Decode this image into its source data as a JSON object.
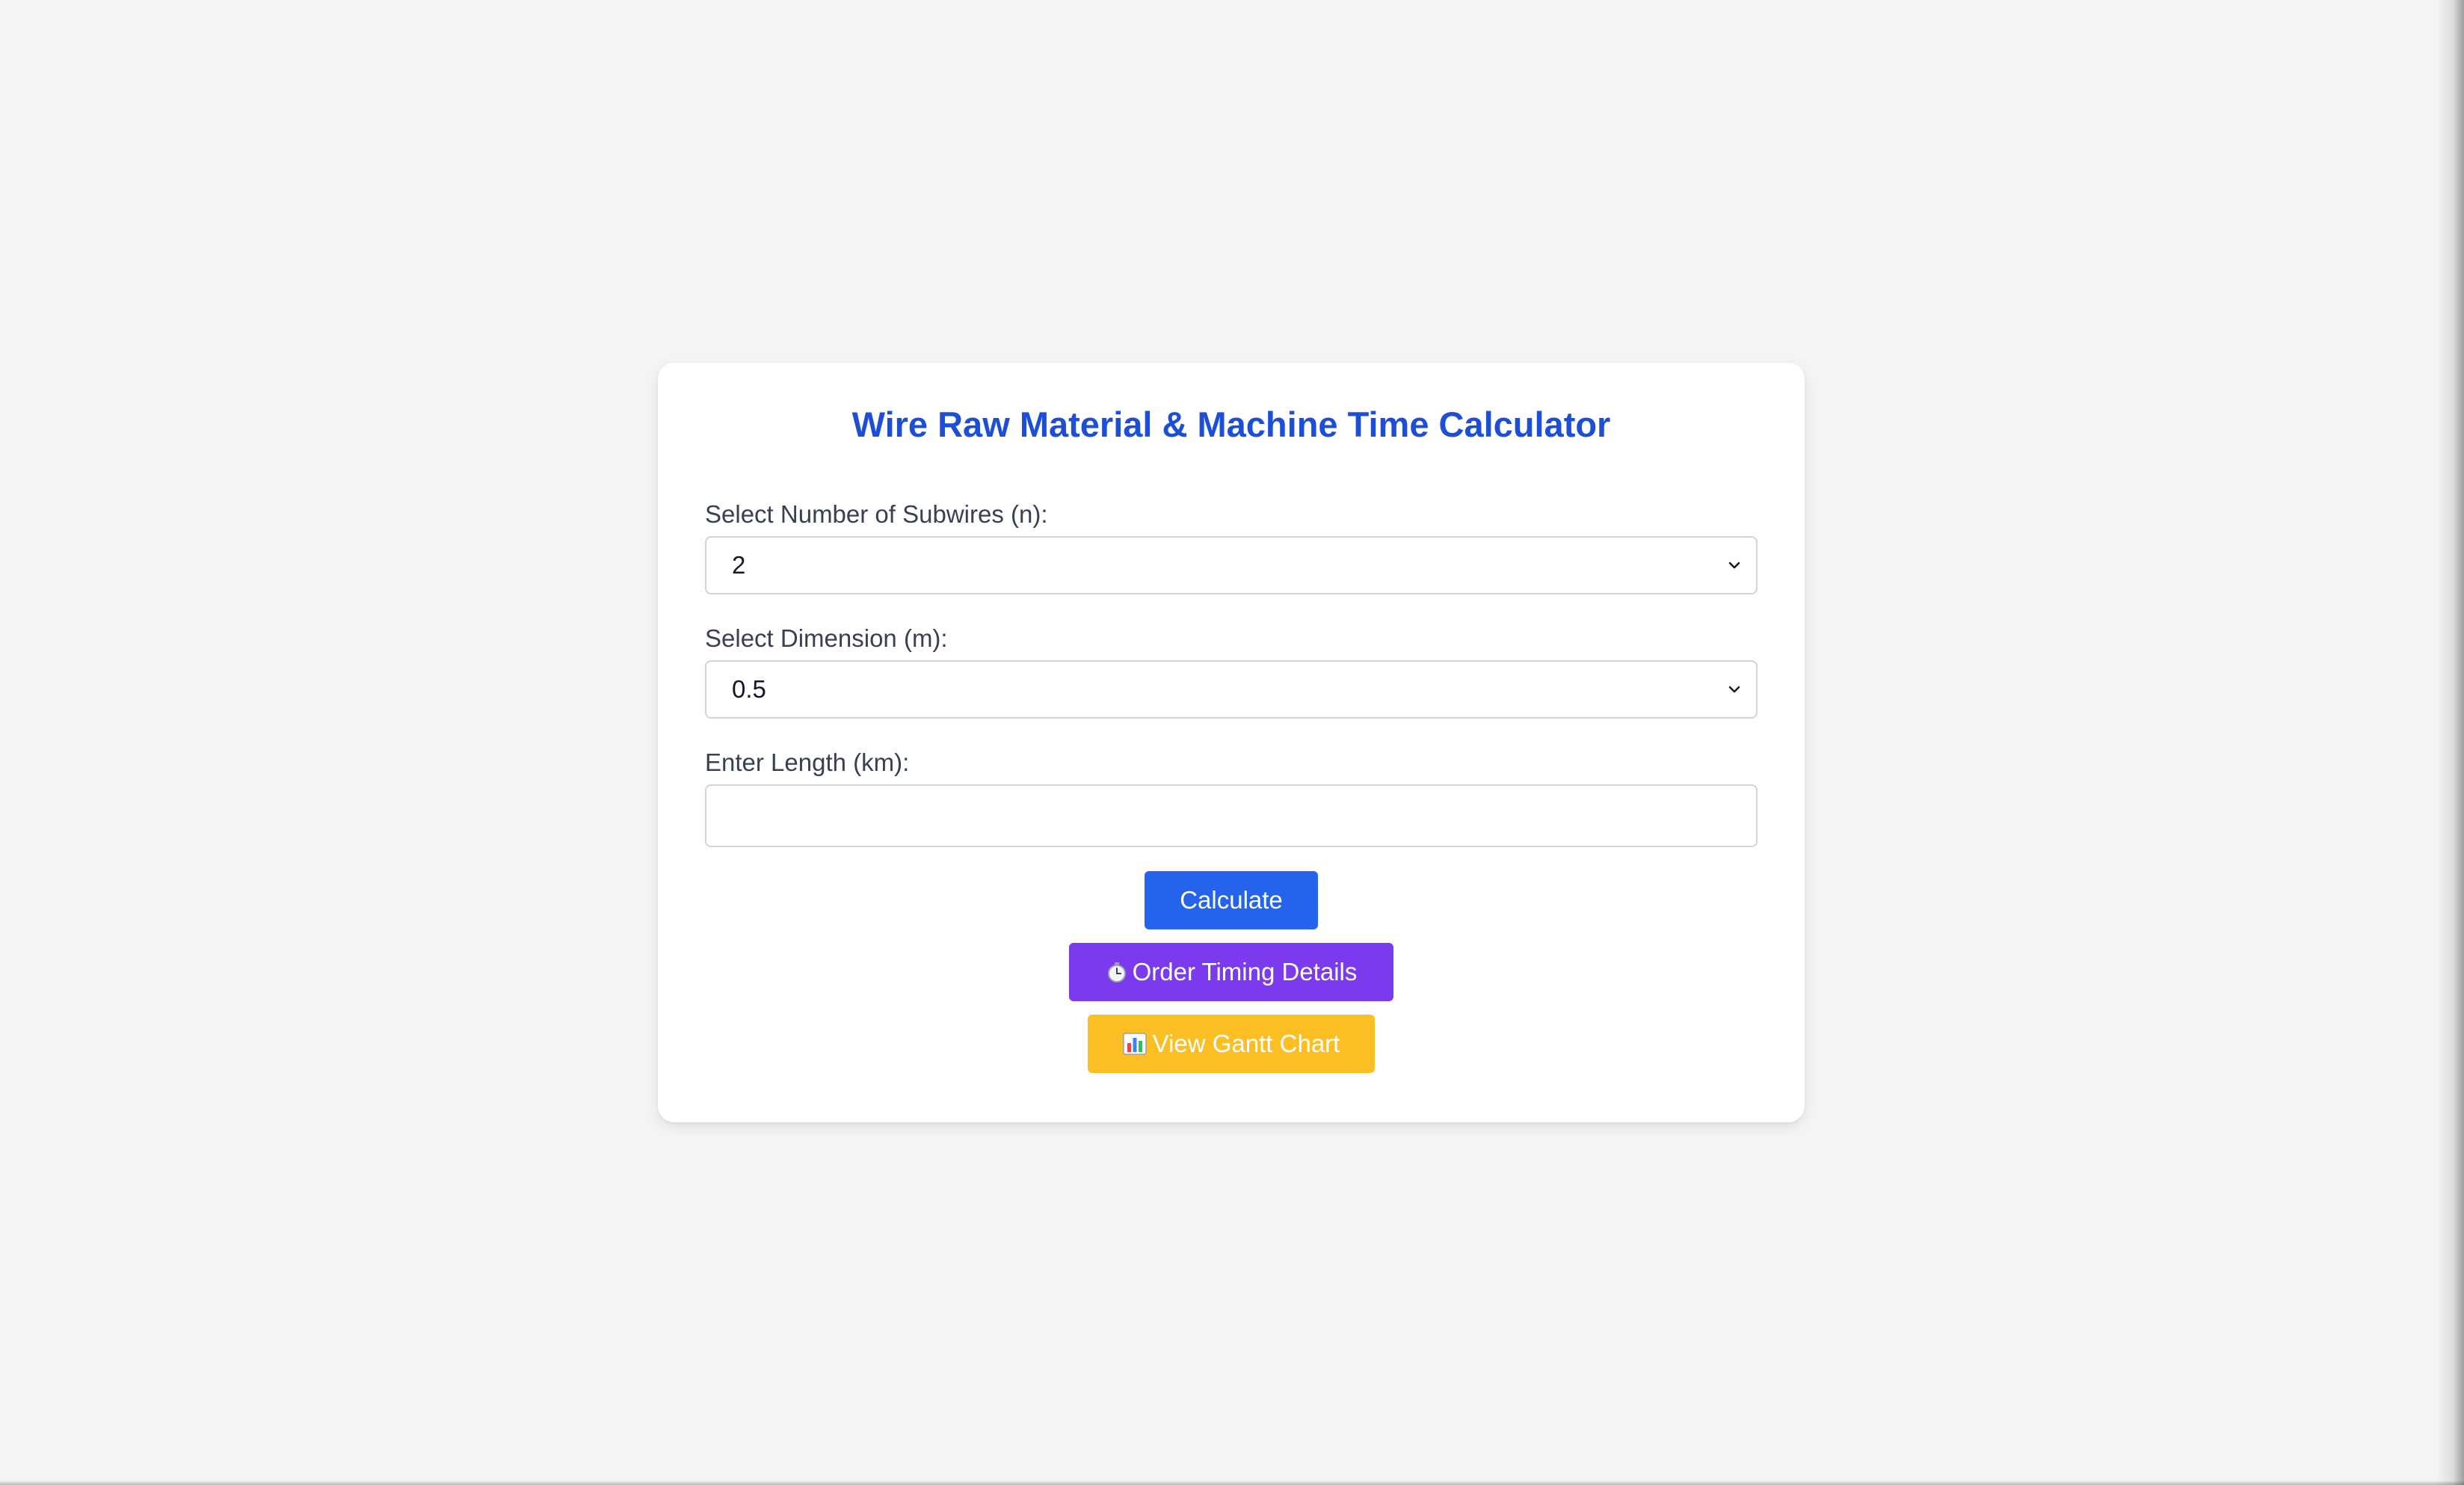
{
  "calculator": {
    "title": "Wire Raw Material & Machine Time Calculator",
    "subwires": {
      "label": "Select Number of Subwires (n):",
      "selected": "2"
    },
    "dimension": {
      "label": "Select Dimension (m):",
      "selected": "0.5"
    },
    "length": {
      "label": "Enter Length (km):",
      "value": "",
      "placeholder": ""
    },
    "buttons": {
      "calculate": "Calculate",
      "order_timing": "Order Timing Details",
      "gantt": "View Gantt Chart"
    },
    "icons": {
      "order_timing": "stopwatch-icon",
      "gantt": "bar-chart-icon",
      "select": "chevron-down-icon"
    }
  },
  "colors": {
    "title": "#1d4ed8",
    "calculate_button": "#2563eb",
    "order_button": "#7c3aed",
    "gantt_button": "#fbbf24",
    "page_background": "#f3f4f6"
  }
}
